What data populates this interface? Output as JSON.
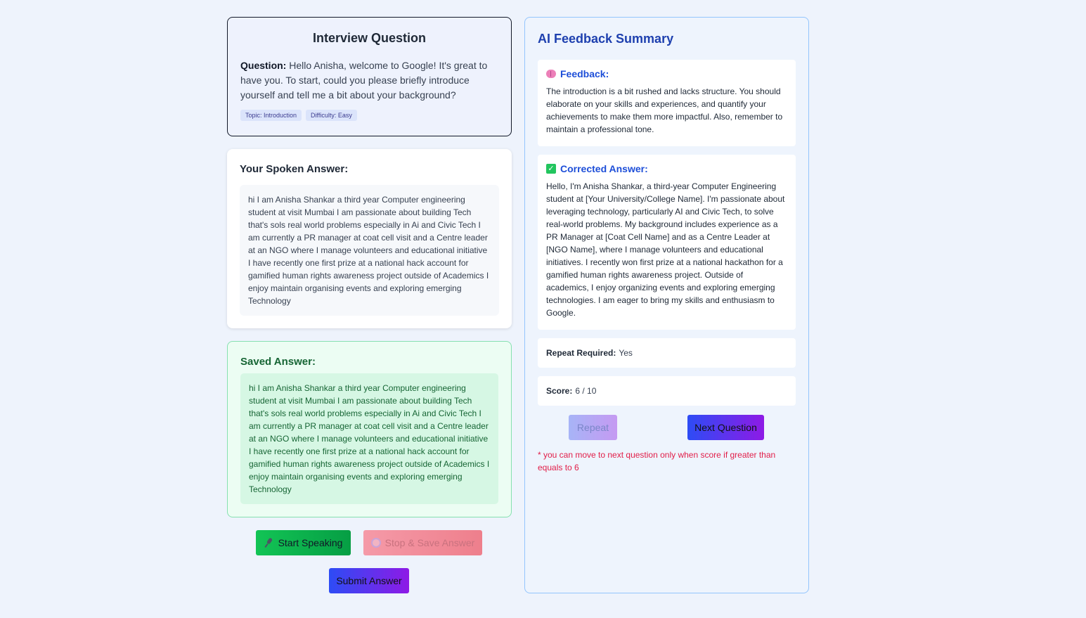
{
  "question_card": {
    "title": "Interview Question",
    "question_label": "Question:",
    "question_text": "Hello Anisha, welcome to Google! It's great to have you. To start, could you please briefly introduce yourself and tell me a bit about your background?",
    "tags": [
      "Topic: Introduction",
      "Difficulty: Easy"
    ]
  },
  "spoken_answer": {
    "heading": "Your Spoken Answer:",
    "text": "hi I am Anisha Shankar a third year Computer engineering student at visit Mumbai I am passionate about building Tech that's sols real world problems especially in Ai and Civic Tech I am currently a PR manager at coat cell visit and a Centre leader at an NGO where I manage volunteers and educational initiative I have recently one first prize at a national hack account for gamified human rights awareness project outside of Academics I enjoy maintain organising events and exploring emerging Technology"
  },
  "saved_answer": {
    "heading": "Saved Answer:",
    "text": "hi I am Anisha Shankar a third year Computer engineering student at visit Mumbai I am passionate about building Tech that's sols real world problems especially in Ai and Civic Tech I am currently a PR manager at coat cell visit and a Centre leader at an NGO where I manage volunteers and educational initiative I have recently one first prize at a national hack account for gamified human rights awareness project outside of Academics I enjoy maintain organising events and exploring emerging Technology"
  },
  "actions": {
    "start_label": "Start Speaking",
    "start_icon": "mic-icon",
    "stop_label": "Stop & Save Answer",
    "stop_icon": "record-icon",
    "submit_label": "Submit Answer"
  },
  "feedback_panel": {
    "title": "AI Feedback Summary",
    "feedback": {
      "label": "Feedback:",
      "icon": "brain-icon",
      "text": "The introduction is a bit rushed and lacks structure. You should elaborate on your skills and experiences, and quantify your achievements to make them more impactful. Also, remember to maintain a professional tone."
    },
    "corrected": {
      "label": "Corrected Answer:",
      "icon": "check-icon",
      "text": "Hello, I'm Anisha Shankar, a third-year Computer Engineering student at [Your University/College Name]. I'm passionate about leveraging technology, particularly AI and Civic Tech, to solve real-world problems. My background includes experience as a PR Manager at [Coat Cell Name] and as a Centre Leader at [NGO Name], where I manage volunteers and educational initiatives. I recently won first prize at a national hackathon for a gamified human rights awareness project. Outside of academics, I enjoy organizing events and exploring emerging technologies. I am eager to bring my skills and enthusiasm to Google."
    },
    "repeat_required_label": "Repeat Required:",
    "repeat_required_value": "Yes",
    "score_label": "Score:",
    "score_value": "6 / 10",
    "repeat_button": "Repeat",
    "next_button": "Next Question",
    "note": "* you can move to next question only when score if greater than equals to 6"
  },
  "colors": {
    "accent_blue": "#1d4ed8",
    "success_green": "#166534",
    "warning_red": "#e11d48"
  }
}
